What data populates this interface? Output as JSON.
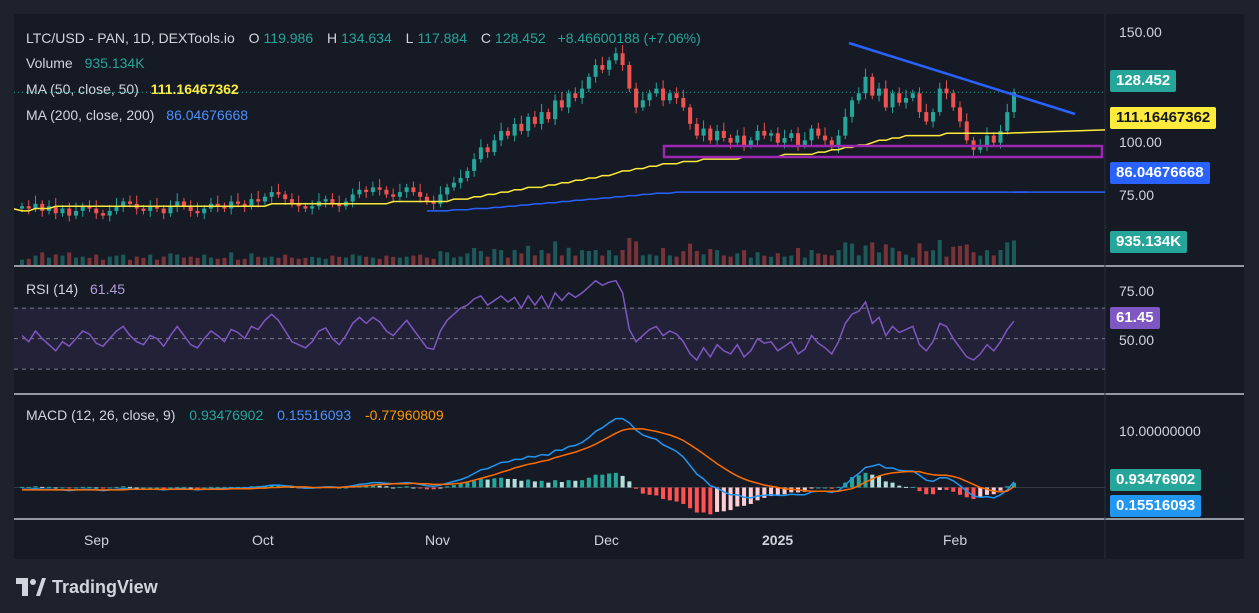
{
  "legend": {
    "symbol": "LTC/USD - PAN, 1D, DEXTools.io",
    "open_k": "O",
    "open": "119.986",
    "high_k": "H",
    "high": "134.634",
    "low_k": "L",
    "low": "117.884",
    "close_k": "C",
    "close": "128.452",
    "change": "+8.46600188 (+7.06%)",
    "volume_k": "Volume",
    "volume": "935.134K",
    "ma50_k": "MA (50, close, 50)",
    "ma50": "111.16467362",
    "ma200_k": "MA (200, close, 200)",
    "ma200": "86.04676668",
    "rsi_k": "RSI (14)",
    "rsi": "61.45",
    "macd_k": "MACD (12, 26, close, 9)",
    "macd": "0.93476902",
    "signal": "0.15516093",
    "hist": "-0.77960809"
  },
  "price_axis": [
    "150.00",
    "100.00",
    "75.00"
  ],
  "rsi_axis": [
    "75.00",
    "50.00"
  ],
  "macd_axis": [
    "10.00000000"
  ],
  "time_axis": [
    "Sep",
    "Oct",
    "Nov",
    "Dec",
    "2025",
    "Feb"
  ],
  "badges": {
    "last_price": "128.452",
    "ma50": "111.16467362",
    "ma200": "86.04676668",
    "volume": "935.134K",
    "rsi": "61.45",
    "macd": "0.93476902",
    "signal": "0.15516093"
  },
  "brand": "TradingView",
  "colors": {
    "up": "#26a69a",
    "down": "#ef5350",
    "ma50": "#ffeb3b",
    "ma200": "#2962ff",
    "rsi": "#7e57c2",
    "macd": "#2196f3",
    "signal": "#ff6d00",
    "trendline": "#2962ff",
    "zone": "#9c27b0",
    "label_green": "#26a69a",
    "label_blue": "#4d8fff",
    "label_orange": "#ff9800",
    "label_purple": "#b39ddb"
  },
  "chart_data": {
    "type": "candlestick",
    "x_ticks": [
      "Sep",
      "Oct",
      "Nov",
      "Dec",
      "2025",
      "Feb"
    ],
    "price_ylim": [
      55,
      160
    ],
    "close": [
      80,
      79,
      81,
      78,
      80,
      77,
      79,
      76,
      78,
      80,
      79,
      77,
      76,
      78,
      80,
      82,
      81,
      79,
      78,
      80,
      79,
      77,
      80,
      82,
      80,
      78,
      77,
      79,
      81,
      80,
      79,
      82,
      81,
      80,
      83,
      82,
      84,
      86,
      85,
      83,
      81,
      80,
      79,
      80,
      82,
      83,
      81,
      80,
      82,
      85,
      87,
      86,
      88,
      87,
      85,
      84,
      86,
      88,
      86,
      84,
      82,
      81,
      85,
      88,
      90,
      92,
      95,
      100,
      105,
      103,
      108,
      112,
      110,
      115,
      112,
      118,
      115,
      120,
      117,
      125,
      122,
      128,
      126,
      130,
      135,
      140,
      138,
      142,
      145,
      140,
      130,
      122,
      125,
      128,
      130,
      125,
      128,
      126,
      122,
      115,
      110,
      113,
      108,
      112,
      109,
      107,
      110,
      106,
      108,
      112,
      110,
      111,
      107,
      109,
      111,
      106,
      108,
      113,
      110,
      108,
      105,
      110,
      118,
      125,
      128,
      135,
      127,
      130,
      122,
      128,
      124,
      126,
      128,
      120,
      116,
      120,
      130,
      128,
      122,
      116,
      108,
      104,
      106,
      110,
      107,
      112,
      120,
      128.452
    ],
    "ma50": [
      78,
      78,
      79,
      79,
      79,
      80,
      80,
      80,
      80,
      80,
      80,
      80,
      80,
      80,
      80,
      80,
      80,
      80,
      80,
      80,
      80,
      80,
      80,
      80,
      80,
      80,
      80,
      80,
      80,
      80,
      80,
      80,
      80,
      80,
      80,
      80,
      80,
      81,
      81,
      81,
      81,
      81,
      81,
      81,
      81,
      81,
      81,
      81,
      81,
      81,
      81,
      81,
      81,
      81,
      81,
      82,
      82,
      82,
      82,
      82,
      82,
      82,
      82,
      82,
      83,
      83,
      83,
      84,
      84,
      85,
      85,
      86,
      86,
      87,
      87,
      88,
      88,
      88,
      89,
      89,
      90,
      90,
      91,
      91,
      92,
      92,
      93,
      93,
      94,
      95,
      95,
      96,
      96,
      97,
      97,
      98,
      98,
      98,
      99,
      99,
      99,
      100,
      100,
      100,
      100,
      100,
      100,
      101,
      101,
      101,
      101,
      101,
      101,
      102,
      102,
      102,
      102,
      102,
      103,
      103,
      104,
      104,
      105,
      105,
      106,
      106,
      107,
      108,
      108,
      109,
      109,
      110,
      110,
      110,
      110,
      110,
      110,
      111,
      111,
      111,
      111,
      111,
      111,
      111,
      111,
      111,
      111,
      111.16
    ],
    "ma200": [
      null,
      null,
      null,
      null,
      null,
      null,
      null,
      null,
      null,
      null,
      null,
      null,
      null,
      null,
      null,
      null,
      null,
      null,
      null,
      null,
      null,
      null,
      null,
      null,
      null,
      null,
      null,
      null,
      null,
      null,
      null,
      null,
      null,
      null,
      null,
      null,
      null,
      null,
      null,
      null,
      null,
      null,
      null,
      null,
      null,
      null,
      null,
      null,
      null,
      null,
      null,
      null,
      null,
      null,
      null,
      null,
      null,
      null,
      null,
      null,
      78,
      78,
      78,
      78,
      78.5,
      78.5,
      78.5,
      79,
      79,
      79,
      79.5,
      79.5,
      80,
      80,
      80.5,
      80.5,
      81,
      81,
      81.5,
      81.5,
      82,
      82,
      82.5,
      82.5,
      83,
      83,
      83.5,
      83.5,
      84,
      84,
      84.5,
      84.5,
      85,
      85,
      85.5,
      85.5,
      85.5,
      86,
      86,
      86,
      86,
      86,
      86,
      86,
      86,
      86,
      86,
      86,
      86,
      86,
      86,
      86,
      86,
      86,
      86,
      86,
      86,
      86,
      86,
      86,
      86,
      86,
      86,
      86,
      86,
      86,
      86,
      86,
      86,
      86,
      86,
      86,
      86,
      86,
      86,
      86,
      86,
      86,
      86,
      86,
      86,
      86,
      86,
      86,
      86,
      86,
      86,
      86,
      86,
      86.05
    ],
    "rsi": [
      52,
      48,
      55,
      50,
      46,
      42,
      48,
      45,
      50,
      55,
      53,
      47,
      45,
      50,
      55,
      58,
      52,
      48,
      46,
      52,
      50,
      45,
      52,
      58,
      52,
      46,
      44,
      50,
      55,
      52,
      48,
      56,
      54,
      50,
      58,
      56,
      62,
      66,
      62,
      55,
      48,
      46,
      44,
      48,
      55,
      57,
      50,
      46,
      52,
      60,
      64,
      60,
      64,
      61,
      55,
      52,
      57,
      62,
      56,
      50,
      44,
      43,
      55,
      62,
      66,
      70,
      72,
      76,
      78,
      72,
      75,
      78,
      74,
      77,
      70,
      78,
      72,
      78,
      70,
      80,
      75,
      80,
      77,
      80,
      84,
      88,
      85,
      87,
      88,
      80,
      56,
      48,
      52,
      56,
      58,
      52,
      55,
      53,
      48,
      40,
      36,
      44,
      38,
      46,
      42,
      40,
      46,
      38,
      42,
      50,
      47,
      48,
      42,
      45,
      48,
      40,
      43,
      52,
      47,
      44,
      40,
      48,
      60,
      66,
      68,
      74,
      60,
      64,
      52,
      58,
      54,
      56,
      58,
      46,
      42,
      48,
      60,
      58,
      50,
      44,
      38,
      36,
      40,
      46,
      42,
      48,
      56,
      61.45
    ],
    "rsi_ylim": [
      15,
      95
    ],
    "macd": [
      -0.3,
      -0.3,
      -0.2,
      -0.3,
      -0.3,
      -0.4,
      -0.4,
      -0.5,
      -0.4,
      -0.3,
      -0.3,
      -0.4,
      -0.5,
      -0.4,
      -0.3,
      -0.2,
      -0.2,
      -0.3,
      -0.3,
      -0.3,
      -0.3,
      -0.4,
      -0.3,
      -0.2,
      -0.2,
      -0.3,
      -0.4,
      -0.3,
      -0.2,
      -0.2,
      -0.2,
      -0.1,
      -0.1,
      -0.1,
      0.0,
      0.1,
      0.2,
      0.4,
      0.4,
      0.3,
      0.2,
      0.0,
      -0.1,
      -0.1,
      0.0,
      0.1,
      0.1,
      0.0,
      0.1,
      0.3,
      0.5,
      0.6,
      0.8,
      0.8,
      0.7,
      0.6,
      0.7,
      0.8,
      0.7,
      0.5,
      0.3,
      0.2,
      0.4,
      0.7,
      1.0,
      1.3,
      1.7,
      2.3,
      2.9,
      3.1,
      3.6,
      4.1,
      4.2,
      4.6,
      4.6,
      5.1,
      5.0,
      5.4,
      5.3,
      6.1,
      6.1,
      6.7,
      6.9,
      7.4,
      8.2,
      9.2,
      9.8,
      10.6,
      11.3,
      11.3,
      10.6,
      9.4,
      8.6,
      8.2,
      7.9,
      7.0,
      6.5,
      5.9,
      5.0,
      3.6,
      2.2,
      1.4,
      0.3,
      -0.1,
      -0.7,
      -1.2,
      -1.2,
      -1.6,
      -1.7,
      -1.4,
      -1.3,
      -1.2,
      -1.3,
      -1.3,
      -1.1,
      -1.2,
      -1.2,
      -0.7,
      -0.6,
      -0.6,
      -0.8,
      -0.5,
      0.4,
      1.5,
      2.3,
      3.3,
      3.5,
      3.8,
      3.2,
      3.2,
      2.8,
      2.7,
      2.7,
      2.0,
      1.2,
      1.0,
      1.6,
      1.6,
      1.1,
      0.3,
      -0.6,
      -1.4,
      -1.6,
      -1.5,
      -1.7,
      -1.2,
      -0.4,
      0.93
    ],
    "signal": [
      -0.4,
      -0.4,
      -0.4,
      -0.4,
      -0.4,
      -0.4,
      -0.4,
      -0.4,
      -0.4,
      -0.4,
      -0.4,
      -0.4,
      -0.4,
      -0.4,
      -0.4,
      -0.4,
      -0.3,
      -0.3,
      -0.3,
      -0.3,
      -0.3,
      -0.3,
      -0.3,
      -0.3,
      -0.3,
      -0.3,
      -0.3,
      -0.3,
      -0.3,
      -0.3,
      -0.3,
      -0.2,
      -0.2,
      -0.2,
      -0.2,
      -0.1,
      -0.1,
      0.0,
      0.0,
      0.1,
      0.1,
      0.1,
      0.1,
      0.0,
      0.0,
      0.0,
      0.0,
      0.0,
      0.1,
      0.1,
      0.2,
      0.3,
      0.4,
      0.5,
      0.5,
      0.6,
      0.6,
      0.6,
      0.7,
      0.6,
      0.6,
      0.5,
      0.5,
      0.5,
      0.6,
      0.7,
      0.9,
      1.2,
      1.5,
      1.8,
      2.1,
      2.5,
      2.8,
      3.2,
      3.5,
      3.8,
      4.0,
      4.3,
      4.5,
      4.9,
      5.2,
      5.5,
      5.8,
      6.2,
      6.6,
      7.1,
      7.7,
      8.3,
      8.9,
      9.4,
      9.6,
      9.6,
      9.6,
      9.4,
      9.2,
      8.9,
      8.6,
      8.2,
      7.7,
      7.0,
      6.3,
      5.5,
      4.7,
      3.9,
      3.2,
      2.5,
      1.9,
      1.4,
      1.0,
      0.7,
      0.4,
      0.2,
      0.0,
      -0.2,
      -0.3,
      -0.4,
      -0.5,
      -0.6,
      -0.6,
      -0.6,
      -0.6,
      -0.6,
      -0.4,
      -0.2,
      0.3,
      0.9,
      1.4,
      1.9,
      2.2,
      2.4,
      2.5,
      2.6,
      2.6,
      2.6,
      2.3,
      2.1,
      2.0,
      2.0,
      1.8,
      1.5,
      1.0,
      0.5,
      0.0,
      -0.3,
      -0.6,
      -0.7,
      -0.6,
      0.16
    ],
    "macd_ylim": [
      -5,
      15
    ]
  }
}
